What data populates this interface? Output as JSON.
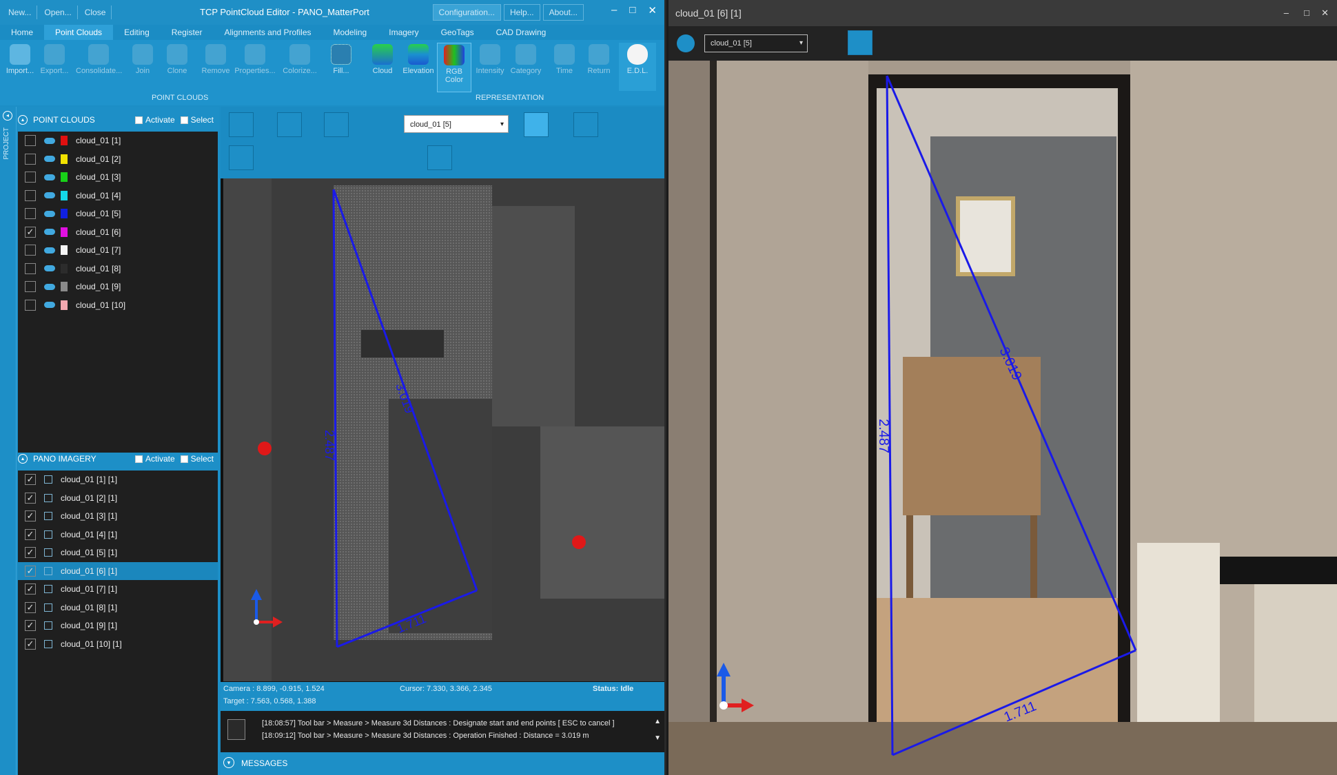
{
  "left_window": {
    "title": "TCP PointCloud Editor - PANO_MatterPort",
    "quick_actions": [
      "New...",
      "Open...",
      "Close"
    ],
    "top_links": [
      "Configuration...",
      "Help...",
      "About..."
    ],
    "ribbon_tabs": [
      "Home",
      "Point Clouds",
      "Editing",
      "Register",
      "Alignments and Profiles",
      "Modeling",
      "Imagery",
      "GeoTags",
      "CAD Drawing"
    ],
    "active_tab": "Point Clouds",
    "ribbon_buttons": [
      {
        "label": "Import...",
        "enabled": true
      },
      {
        "label": "Export...",
        "enabled": false
      },
      {
        "label": "Consolidate...",
        "enabled": false
      },
      {
        "label": "Join",
        "enabled": false
      },
      {
        "label": "Clone",
        "enabled": false
      },
      {
        "label": "Remove",
        "enabled": false
      },
      {
        "label": "Properties...",
        "enabled": false
      },
      {
        "label": "Colorize...",
        "enabled": false
      },
      {
        "label": "Fill...",
        "enabled": true
      },
      {
        "label": "Cloud",
        "enabled": true
      },
      {
        "label": "Elevation",
        "enabled": true
      },
      {
        "label": "RGB Color",
        "enabled": true,
        "selected": true
      },
      {
        "label": "Intensity",
        "enabled": false
      },
      {
        "label": "Category",
        "enabled": false
      },
      {
        "label": "Time",
        "enabled": false
      },
      {
        "label": "Return",
        "enabled": false
      },
      {
        "label": "E.D.L.",
        "enabled": true
      }
    ],
    "group_labels": {
      "point_clouds": "POINT CLOUDS",
      "representation": "REPRESENTATION"
    },
    "project_tab": "PROJECT",
    "point_clouds_panel": {
      "title": "POINT CLOUDS",
      "activate": "Activate",
      "select": "Select",
      "items": [
        {
          "name": "cloud_01 [1]",
          "checked": false,
          "color": "#e01010"
        },
        {
          "name": "cloud_01 [2]",
          "checked": false,
          "color": "#f2e200"
        },
        {
          "name": "cloud_01 [3]",
          "checked": false,
          "color": "#18d018"
        },
        {
          "name": "cloud_01 [4]",
          "checked": false,
          "color": "#14d8e8"
        },
        {
          "name": "cloud_01 [5]",
          "checked": false,
          "color": "#1020e0"
        },
        {
          "name": "cloud_01 [6]",
          "checked": true,
          "color": "#e010e0"
        },
        {
          "name": "cloud_01 [7]",
          "checked": false,
          "color": "#f4f4f4"
        },
        {
          "name": "cloud_01 [8]",
          "checked": false,
          "color": "#2c2c2c"
        },
        {
          "name": "cloud_01 [9]",
          "checked": false,
          "color": "#8a8a8a"
        },
        {
          "name": "cloud_01 [10]",
          "checked": false,
          "color": "#f4a8b0"
        }
      ]
    },
    "pano_panel": {
      "title": "PANO IMAGERY",
      "activate": "Activate",
      "select": "Select",
      "items": [
        {
          "name": "cloud_01 [1] [1]",
          "checked": true
        },
        {
          "name": "cloud_01 [2] [1]",
          "checked": true
        },
        {
          "name": "cloud_01 [3] [1]",
          "checked": true
        },
        {
          "name": "cloud_01 [4] [1]",
          "checked": true
        },
        {
          "name": "cloud_01 [5] [1]",
          "checked": true
        },
        {
          "name": "cloud_01 [6] [1]",
          "checked": true,
          "selected": true
        },
        {
          "name": "cloud_01 [7] [1]",
          "checked": true
        },
        {
          "name": "cloud_01 [8] [1]",
          "checked": true
        },
        {
          "name": "cloud_01 [9] [1]",
          "checked": true
        },
        {
          "name": "cloud_01 [10] [1]",
          "checked": true
        }
      ]
    },
    "viewer": {
      "combo_value": "cloud_01 [5]",
      "measure_labels": {
        "vertical": "2.487",
        "diagonal": "3.019",
        "horizontal": "1.711"
      },
      "status": {
        "camera": "Camera : 8.899, -0.915, 1.524",
        "target": "Target : 7.563, 0.568, 1.388",
        "cursor": "Cursor: 7.330, 3.366, 2.345",
        "state": "Status: Idle"
      },
      "messages": [
        "[18:08:57] Tool bar > Measure > Measure 3d Distances : Designate start and end points [ ESC to cancel ]",
        "[18:09:12] Tool bar > Measure > Measure 3d Distances : Operation Finished : Distance = 3.019 m"
      ],
      "messages_label": "MESSAGES"
    }
  },
  "right_window": {
    "title": "cloud_01 [6] [1]",
    "combo_value": "cloud_01 [5]",
    "measure_labels": {
      "vertical": "2.487",
      "diagonal": "3.019",
      "horizontal": "1.711"
    }
  },
  "colors": {
    "accent": "#1d8fc7",
    "measure_line": "#1a1ae8",
    "marker": "#e01818"
  }
}
